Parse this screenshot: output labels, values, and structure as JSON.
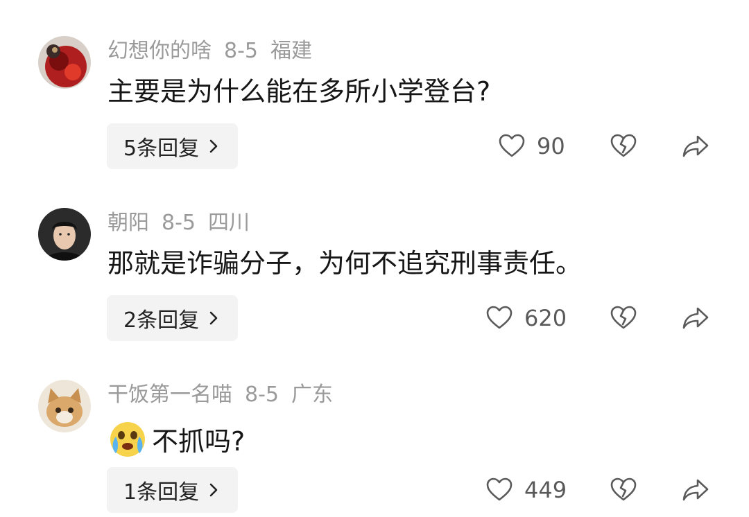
{
  "comments": [
    {
      "username": "幻想你的啥",
      "date": "8-5",
      "location": "福建",
      "text": "主要是为什么能在多所小学登台?",
      "replies": "5条回复",
      "likes": "90",
      "avatar": "red-costume-avatar"
    },
    {
      "username": "朝阳",
      "date": "8-5",
      "location": "四川",
      "text": "那就是诈骗分子，为何不追究刑事责任。",
      "replies": "2条回复",
      "likes": "620",
      "avatar": "man-portrait-avatar"
    },
    {
      "username": "干饭第一名喵",
      "date": "8-5",
      "location": "广东",
      "text": "不抓吗?",
      "emoji": "crying-face-emoji",
      "replies": "1条回复",
      "likes": "449",
      "avatar": "cat-avatar"
    }
  ],
  "icons": {
    "like": "heart-outline-icon",
    "dislike": "broken-heart-icon",
    "share": "share-arrow-icon",
    "chevron": "chevron-right-icon"
  },
  "colors": {
    "meta_text": "#9a9a9a",
    "body_text": "#161616",
    "reply_bg": "#f3f3f3",
    "icon": "#5a5a5a"
  }
}
